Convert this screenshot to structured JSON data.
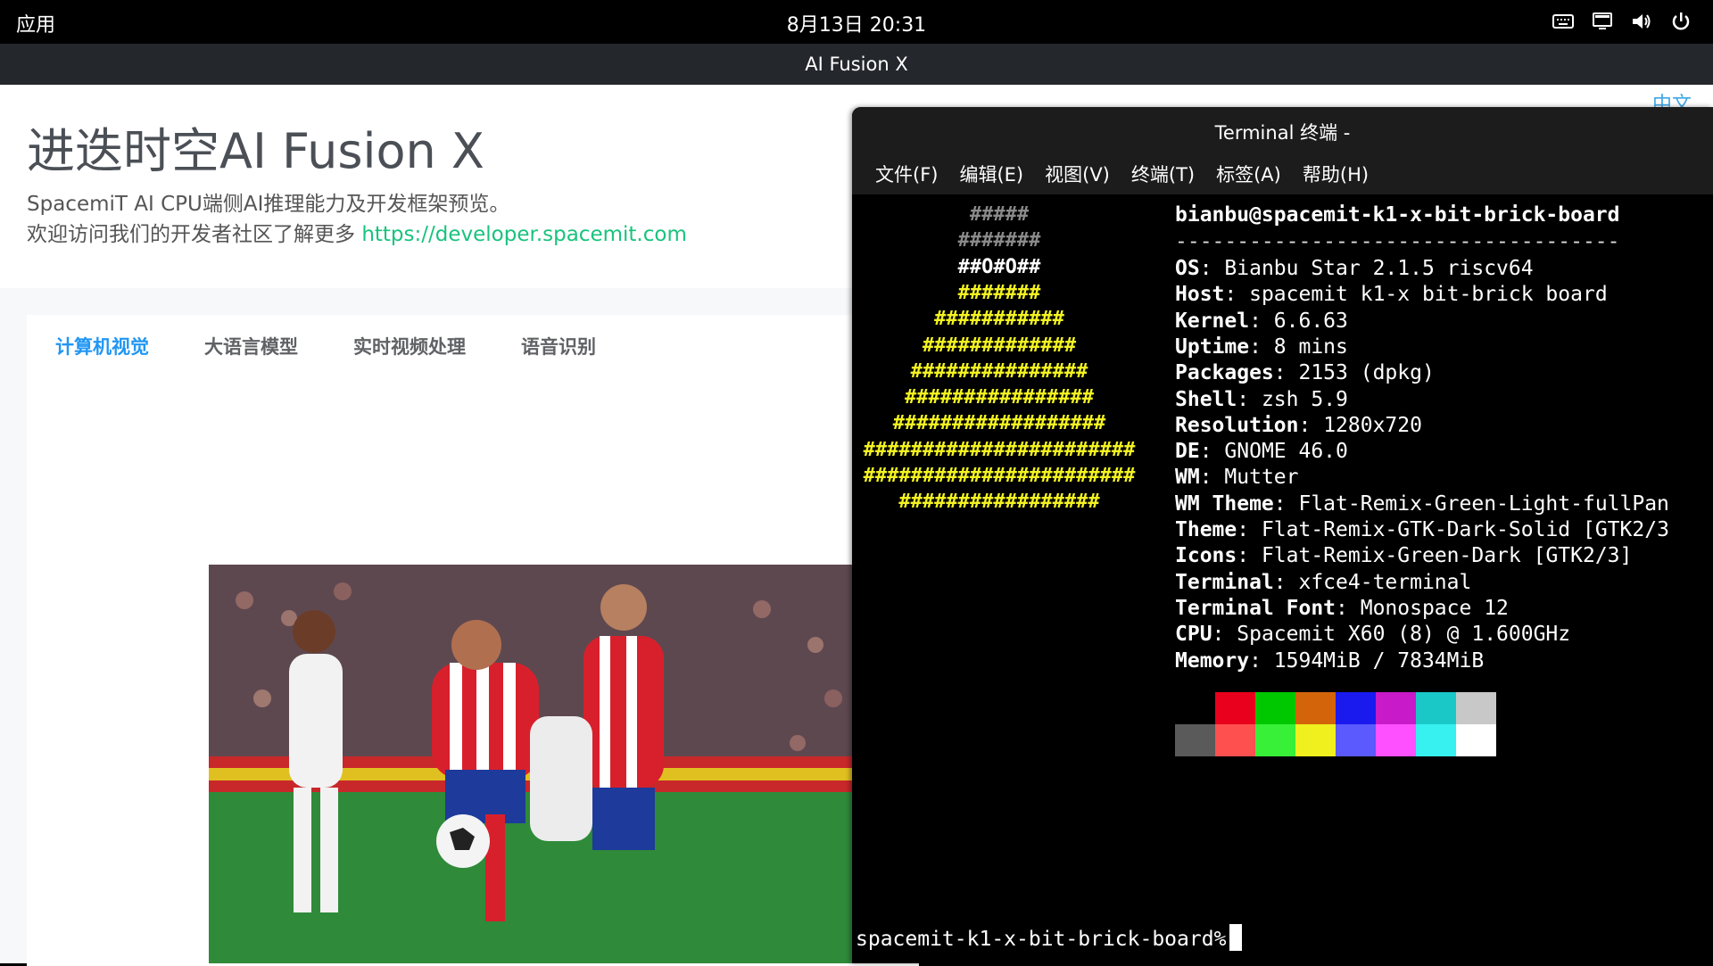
{
  "topbar": {
    "apps_label": "应用",
    "clock": "8月13日 20:31",
    "icons": [
      "keyboard-icon",
      "display-icon",
      "volume-icon",
      "power-icon"
    ]
  },
  "app_window": {
    "title": "AI Fusion X"
  },
  "app": {
    "title": "进迭时空AI Fusion X",
    "subtitle": "SpacemiT AI CPU端侧AI推理能力及开发框架预览。",
    "community_text": "欢迎访问我们的开发者社区了解更多",
    "community_link": "https://developer.spacemit.com",
    "lang_label": "中文",
    "tabs": [
      {
        "label": "计算机视觉",
        "active": true
      },
      {
        "label": "大语言模型",
        "active": false
      },
      {
        "label": "实时视频处理",
        "active": false
      },
      {
        "label": "语音识别",
        "active": false
      }
    ],
    "accent_color": "#2196f3",
    "link_color": "#19c37d"
  },
  "terminal": {
    "title": "Terminal 终端 -",
    "menu": [
      "文件(F)",
      "编辑(E)",
      "视图(V)",
      "终端(T)",
      "标签(A)",
      "帮助(H)"
    ],
    "user_host": "bianbu@spacemit-k1-x-bit-brick-board",
    "separator": "------------------------------------",
    "info": [
      {
        "key": "OS",
        "value": "Bianbu Star 2.1.5 riscv64"
      },
      {
        "key": "Host",
        "value": "spacemit k1-x bit-brick board"
      },
      {
        "key": "Kernel",
        "value": "6.6.63"
      },
      {
        "key": "Uptime",
        "value": "8 mins"
      },
      {
        "key": "Packages",
        "value": "2153 (dpkg)"
      },
      {
        "key": "Shell",
        "value": "zsh 5.9"
      },
      {
        "key": "Resolution",
        "value": "1280x720"
      },
      {
        "key": "DE",
        "value": "GNOME 46.0"
      },
      {
        "key": "WM",
        "value": "Mutter"
      },
      {
        "key": "WM Theme",
        "value": "Flat-Remix-Green-Light-fullPan"
      },
      {
        "key": "Theme",
        "value": "Flat-Remix-GTK-Dark-Solid [GTK2/3"
      },
      {
        "key": "Icons",
        "value": "Flat-Remix-Green-Dark [GTK2/3]"
      },
      {
        "key": "Terminal",
        "value": "xfce4-terminal"
      },
      {
        "key": "Terminal Font",
        "value": "Monospace 12"
      },
      {
        "key": "CPU",
        "value": "Spacemit X60 (8) @ 1.600GHz"
      },
      {
        "key": "Memory",
        "value": "1594MiB / 7834MiB"
      }
    ],
    "logo_lines": [
      "#####",
      "#######",
      "##O#O##",
      "#######",
      "###########",
      "#############",
      "###############",
      "################",
      "##################",
      "#######################",
      "#######################",
      "#################"
    ],
    "palette_top": [
      "#000000",
      "#e8001c",
      "#00c800",
      "#d4640a",
      "#1a1aef",
      "#c81ac8",
      "#1ac8c8",
      "#c8c8c8"
    ],
    "palette_bottom": [
      "#5a5a5a",
      "#ff5050",
      "#37f037",
      "#f0f01e",
      "#5a5aff",
      "#ff50ff",
      "#37f0f0",
      "#ffffff"
    ],
    "prompt": "spacemit-k1-x-bit-brick-board%"
  }
}
